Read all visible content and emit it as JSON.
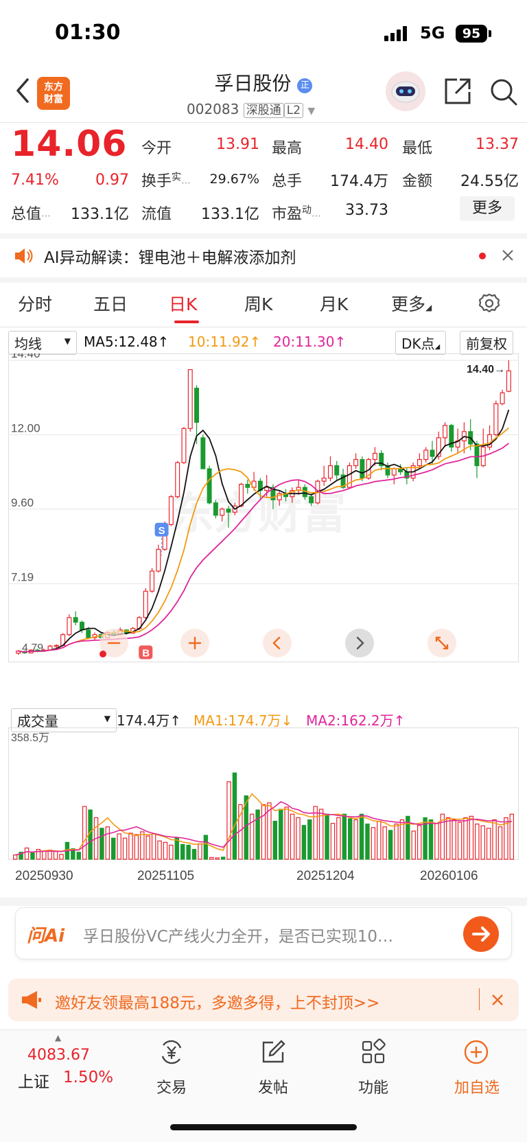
{
  "status_bar": {
    "time": "01:30",
    "network": "5G",
    "battery": "95"
  },
  "header": {
    "logo_text_1": "东方",
    "logo_text_2": "财富",
    "stock_name": "孚日股份",
    "stock_code": "002083",
    "tag_connect": "深股通",
    "tag_level": "L2"
  },
  "quote": {
    "price": "14.06",
    "change_pct": "7.41%",
    "change_amt": "0.97",
    "open_label": "今开",
    "open": "13.91",
    "high_label": "最高",
    "high": "14.40",
    "low_label": "最低",
    "low": "13.37",
    "turnover_label": "换手",
    "turnover_sup": "实",
    "turnover": "29.67%",
    "volume_label": "总手",
    "volume": "174.4万",
    "amount_label": "金额",
    "amount": "24.55亿",
    "mktcap_label": "总值",
    "mktcap": "133.1亿",
    "float_label": "流值",
    "float_cap": "133.1亿",
    "pe_label": "市盈",
    "pe_sup": "动",
    "pe": "33.73",
    "more_label": "更多"
  },
  "ai_banner": {
    "text": "AI异动解读：锂电池＋电解液添加剂"
  },
  "tabs": [
    {
      "label": "分时"
    },
    {
      "label": "五日"
    },
    {
      "label": "日K"
    },
    {
      "label": "周K"
    },
    {
      "label": "月K"
    },
    {
      "label": "更多"
    }
  ],
  "kline_header": {
    "indicator": "均线",
    "ma5": "MA5:12.48↑",
    "ma10": "10:11.92↑",
    "ma20": "20:11.30↑",
    "dk": "DK点",
    "adjust": "前复权"
  },
  "chart_colors": {
    "up": "#e8232a",
    "down": "#1a9a30",
    "ma5": "#111111",
    "ma10": "#f29a12",
    "ma20": "#e0259a"
  },
  "chart_data": {
    "type": "candlestick",
    "y_ticks": [
      "14.40",
      "12.00",
      "9.60",
      "7.19"
    ],
    "y_tick_values": [
      14.4,
      12.0,
      9.6,
      7.19
    ],
    "ylim": [
      4.79,
      14.4
    ],
    "last_price_label": "14.40→",
    "low_label": "4.79",
    "marks": {
      "sell": "S",
      "buy": "B"
    },
    "candles": [
      [
        4.95,
        5.02,
        4.9,
        5.05
      ],
      [
        5.0,
        4.96,
        4.93,
        5.04
      ],
      [
        4.96,
        5.05,
        4.94,
        5.08
      ],
      [
        5.05,
        5.02,
        4.98,
        5.09
      ],
      [
        5.02,
        5.05,
        4.99,
        5.1
      ],
      [
        5.05,
        5.18,
        5.03,
        5.22
      ],
      [
        5.18,
        5.2,
        5.12,
        5.24
      ],
      [
        5.2,
        5.55,
        5.18,
        5.6
      ],
      [
        5.55,
        6.1,
        5.5,
        6.2
      ],
      [
        6.1,
        5.95,
        5.85,
        6.3
      ],
      [
        5.95,
        5.7,
        5.6,
        6.0
      ],
      [
        5.7,
        5.45,
        5.4,
        5.8
      ],
      [
        5.45,
        5.55,
        5.38,
        5.62
      ],
      [
        5.55,
        5.45,
        5.4,
        5.6
      ],
      [
        5.45,
        5.62,
        5.42,
        5.66
      ],
      [
        5.62,
        5.55,
        5.5,
        5.7
      ],
      [
        5.55,
        5.7,
        5.52,
        5.78
      ],
      [
        5.7,
        5.6,
        5.55,
        5.72
      ],
      [
        5.6,
        5.75,
        5.58,
        5.8
      ],
      [
        5.75,
        6.1,
        5.7,
        6.15
      ],
      [
        6.1,
        6.95,
        6.05,
        7.05
      ],
      [
        6.95,
        7.6,
        6.9,
        7.7
      ],
      [
        7.6,
        8.3,
        7.55,
        8.45
      ],
      [
        8.3,
        9.1,
        8.25,
        9.2
      ],
      [
        9.1,
        10.0,
        9.05,
        10.05
      ],
      [
        10.0,
        11.1,
        9.95,
        11.15
      ],
      [
        11.1,
        12.2,
        11.05,
        12.25
      ],
      [
        12.2,
        14.1,
        12.1,
        14.1
      ],
      [
        13.5,
        12.4,
        11.7,
        13.6
      ],
      [
        11.9,
        10.9,
        10.9,
        12.0
      ],
      [
        10.9,
        9.8,
        9.75,
        11.0
      ],
      [
        9.8,
        9.4,
        9.3,
        9.9
      ],
      [
        9.4,
        9.6,
        9.2,
        9.65
      ],
      [
        9.6,
        9.5,
        9.0,
        9.7
      ],
      [
        9.5,
        9.7,
        9.4,
        9.8
      ],
      [
        9.7,
        10.4,
        9.65,
        10.45
      ],
      [
        10.4,
        10.3,
        10.1,
        10.55
      ],
      [
        10.3,
        10.5,
        10.2,
        10.8
      ],
      [
        10.5,
        10.2,
        9.9,
        10.6
      ],
      [
        10.2,
        10.3,
        10.0,
        10.7
      ],
      [
        10.3,
        9.9,
        9.6,
        10.4
      ],
      [
        9.9,
        10.1,
        9.7,
        10.2
      ],
      [
        10.1,
        10.0,
        9.85,
        10.25
      ],
      [
        10.0,
        10.2,
        9.8,
        10.3
      ],
      [
        10.2,
        10.3,
        10.05,
        10.55
      ],
      [
        10.3,
        10.0,
        9.9,
        10.4
      ],
      [
        10.0,
        9.8,
        9.7,
        10.1
      ],
      [
        9.8,
        10.5,
        9.75,
        10.55
      ],
      [
        10.5,
        10.6,
        10.35,
        11.0
      ],
      [
        10.6,
        11.0,
        10.5,
        11.3
      ],
      [
        11.0,
        10.7,
        10.55,
        11.15
      ],
      [
        10.7,
        10.3,
        10.25,
        10.9
      ],
      [
        10.3,
        11.0,
        10.25,
        11.1
      ],
      [
        11.0,
        11.2,
        10.9,
        11.4
      ],
      [
        11.2,
        10.6,
        10.5,
        11.3
      ],
      [
        10.6,
        11.2,
        10.55,
        11.25
      ],
      [
        11.2,
        11.4,
        11.0,
        11.6
      ],
      [
        11.4,
        11.0,
        10.85,
        11.5
      ],
      [
        11.0,
        10.7,
        10.6,
        11.1
      ],
      [
        10.7,
        10.9,
        10.4,
        10.95
      ],
      [
        10.9,
        10.8,
        10.7,
        11.05
      ],
      [
        10.8,
        10.6,
        10.4,
        10.95
      ],
      [
        10.6,
        11.0,
        10.5,
        11.1
      ],
      [
        11.0,
        11.2,
        10.9,
        11.4
      ],
      [
        11.2,
        11.5,
        11.1,
        11.6
      ],
      [
        11.5,
        11.3,
        11.05,
        11.8
      ],
      [
        11.3,
        11.9,
        11.2,
        12.1
      ],
      [
        11.9,
        12.3,
        11.6,
        12.4
      ],
      [
        12.3,
        11.6,
        11.45,
        12.35
      ],
      [
        11.6,
        11.8,
        11.4,
        12.2
      ],
      [
        11.8,
        12.1,
        11.4,
        12.4
      ],
      [
        12.1,
        11.7,
        11.5,
        12.5
      ],
      [
        11.7,
        11.0,
        10.6,
        11.8
      ],
      [
        11.0,
        11.6,
        10.95,
        12.2
      ],
      [
        11.6,
        12.0,
        11.5,
        12.3
      ],
      [
        12.0,
        13.0,
        11.95,
        13.1
      ],
      [
        13.0,
        13.35,
        12.95,
        13.45
      ],
      [
        13.4,
        14.06,
        13.37,
        14.4
      ]
    ],
    "volume": {
      "label": "成交量",
      "value": "174.4万↑",
      "ma1": "MA1:174.7万↓",
      "ma2": "MA2:162.2万↑",
      "max_label": "358.5万",
      "ymax": 358.5,
      "unit": "万",
      "x_labels": [
        "20250930",
        "20251105",
        "20251204",
        "20260106"
      ],
      "values": [
        12,
        20,
        32,
        18,
        28,
        24,
        26,
        22,
        14,
        48,
        30,
        20,
        150,
        140,
        118,
        88,
        92,
        60,
        72,
        60,
        74,
        70,
        78,
        66,
        72,
        52,
        48,
        40,
        62,
        42,
        40,
        28,
        44,
        68,
        5,
        4,
        6,
        220,
        245,
        155,
        180,
        128,
        140,
        155,
        160,
        108,
        142,
        148,
        128,
        118,
        96,
        112,
        150,
        142,
        128,
        102,
        118,
        128,
        115,
        112,
        128,
        100,
        90,
        108,
        92,
        82,
        100,
        112,
        122,
        80,
        96,
        118,
        112,
        102,
        128,
        118,
        112,
        105,
        118,
        122,
        100,
        95,
        88,
        112,
        92,
        118,
        128
      ]
    }
  },
  "toolbar_icons": [
    "minus-icon",
    "plus-icon",
    "chevron-left-icon",
    "chevron-right-icon",
    "expand-icon"
  ],
  "ask_bar": {
    "logo": "问Ai",
    "placeholder": "孚日股份VC产线火力全开，是否已实现10…"
  },
  "promo": {
    "text": "邀好友领最高188元，多邀多得，上不封顶>>"
  },
  "bottom_nav": {
    "index_value": "4083.67",
    "index_name": "上证",
    "index_change": "1.50%",
    "trade": "交易",
    "post": "发帖",
    "function": "功能",
    "add_watch": "加自选"
  }
}
